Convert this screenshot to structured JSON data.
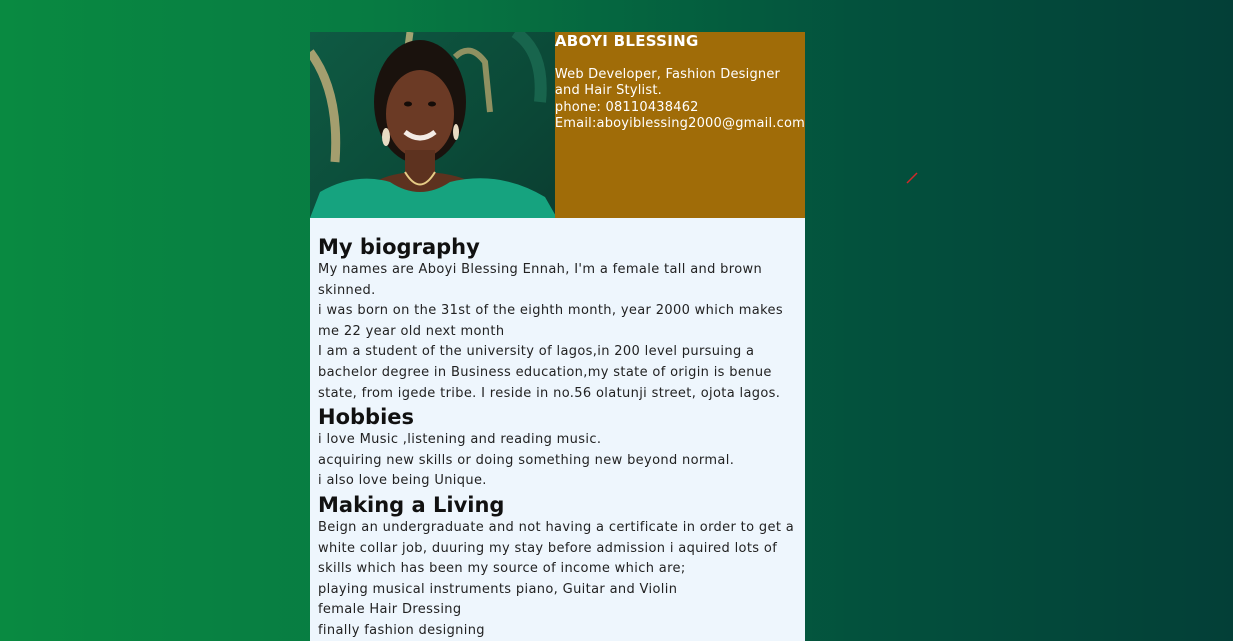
{
  "profile": {
    "name": "ABOYI BLESSING",
    "role": "Web Developer, Fashion Designer and Hair Stylist.",
    "phone": "phone: 08110438462",
    "email": "Email:aboyiblessing2000@gmail.com"
  },
  "biography": {
    "heading": "My biography",
    "paragraphs": [
      "My names are Aboyi Blessing Ennah, I'm a female tall and brown skinned.",
      "i was born on the 31st of the eighth month, year 2000 which makes me 22 year old next month",
      "I am a student of the university of lagos,in 200 level pursuing a bachelor degree in Business education,my state of origin is benue state, from igede tribe. I reside in no.56 olatunji street, ojota lagos."
    ]
  },
  "hobbies": {
    "heading": "Hobbies",
    "items": [
      "i love Music ,listening and reading music.",
      "acquiring new skills or doing something new beyond normal.",
      "i also love being Unique."
    ]
  },
  "living": {
    "heading": "Making a Living",
    "items": [
      "Beign an undergraduate and not having a certificate in order to get a white collar job, duuring my stay before admission i aquired lots of skills which has been my source of income which are;",
      "playing musical instruments piano, Guitar and Violin",
      "female Hair Dressing",
      "finally fashion designing"
    ]
  },
  "colors": {
    "header_bg": "#a06c08",
    "card_bg": "#eef6fd",
    "page_gradient_start": "#098a41",
    "page_gradient_end": "#033f37"
  }
}
